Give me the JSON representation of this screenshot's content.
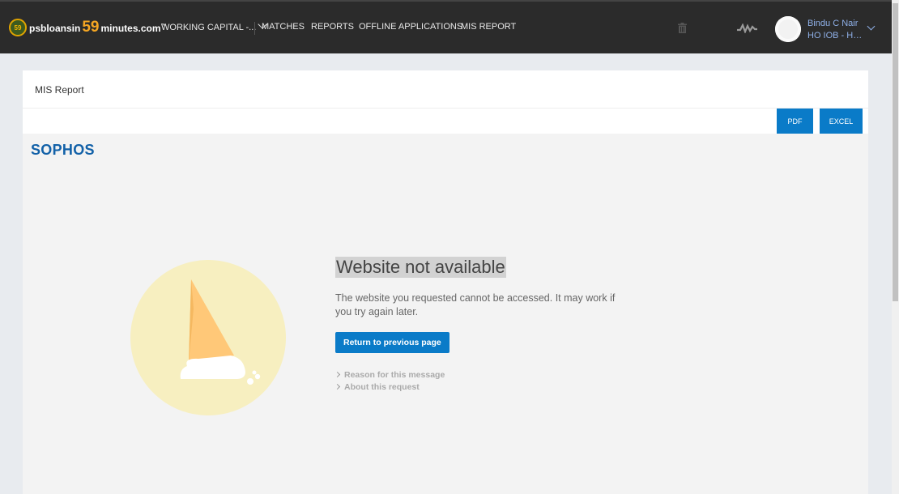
{
  "header": {
    "logo": {
      "badge": "59",
      "prefix": "psbloansin",
      "number": "59",
      "suffix": "minutes.com",
      "tm": "™"
    },
    "nav": [
      {
        "label": "WORKING CAPITAL -...",
        "has_dropdown": true
      },
      {
        "label": "MATCHES"
      },
      {
        "label": "REPORTS"
      },
      {
        "label": "OFFLINE APPLICATIONS"
      },
      {
        "label": "MIS REPORT"
      }
    ],
    "icons": [
      "trash-icon",
      "activity-icon"
    ],
    "user": {
      "name": "Bindu C Nair",
      "role": "HO IOB - Hea..."
    }
  },
  "card": {
    "title": "MIS Report",
    "buttons": {
      "pdf": "PDF",
      "excel": "EXCEL"
    }
  },
  "error_page": {
    "brand": "SOPHOS",
    "title": "Website not available",
    "message": "The website you requested cannot be accessed. It may work if you try again later.",
    "return_button": "Return to previous page",
    "links": [
      "Reason for this message",
      "About this request"
    ]
  },
  "colors": {
    "topbar": "#2b2b2b",
    "accent": "#0a7bc8",
    "brand": "#1261a8",
    "illustration_bg": "#f7efc0",
    "sail": "#ffc878"
  }
}
